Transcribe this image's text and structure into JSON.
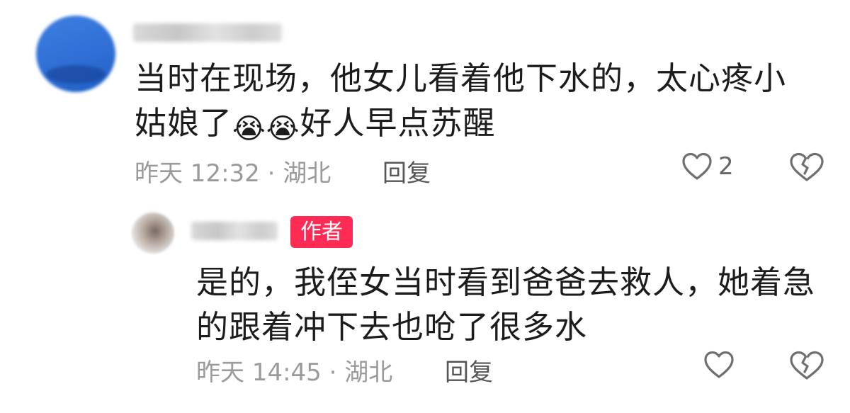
{
  "comments": [
    {
      "text_line1": "当时在现场，他女儿看着他下水的，太心疼小",
      "text_line2_a": "姑娘了",
      "emoji_1": "😭",
      "emoji_2": "😭",
      "text_line2_b": "好人早点苏醒",
      "meta": "昨天 12:32 · 湖北",
      "reply_label": "回复",
      "like_count": "2",
      "icons": [
        "heart-icon",
        "broken-heart-icon"
      ]
    }
  ],
  "reply": {
    "badge": "作者",
    "text_line1": "是的，我侄女当时看到爸爸去救人，她着急",
    "text_line2": "的跟着冲下去也呛了很多水",
    "meta": "昨天 14:45 · 湖北",
    "reply_label": "回复",
    "icons": [
      "heart-icon",
      "broken-heart-icon"
    ]
  },
  "colors": {
    "badge_bg": "#fe2c55",
    "meta_text": "#9a9a9a",
    "icon_stroke": "#6f6f6f"
  }
}
